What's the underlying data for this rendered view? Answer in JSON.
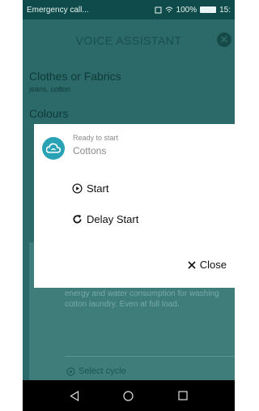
{
  "status_bar": {
    "left_text": "Emergency call...",
    "battery": "100%",
    "time": "15:"
  },
  "header": {
    "title": "VOICE ASSISTANT"
  },
  "background": {
    "clothes_title": "Clothes or Fabrics",
    "clothes_sub": "jeans, cotton",
    "colours_title": "Colours",
    "description": "to clean normally dirty cotton laundry. It is the most efficient cycle in terms of combined energy and water consumption for washing cotton laundry. Even at full load.",
    "select_cycle": "Select cycle"
  },
  "dialog": {
    "status": "Ready to start",
    "program": "Cottons",
    "start_label": "Start",
    "delay_label": "Delay Start",
    "close_label": "Close"
  },
  "colors": {
    "status_bar": "#0f4b4a",
    "overlay_bg": "#2b6a68",
    "accent": "#2aa2b5"
  },
  "icons": [
    "play-circle-icon",
    "refresh-icon",
    "close-icon",
    "cloud-icon",
    "back-icon",
    "home-icon",
    "recents-icon"
  ]
}
